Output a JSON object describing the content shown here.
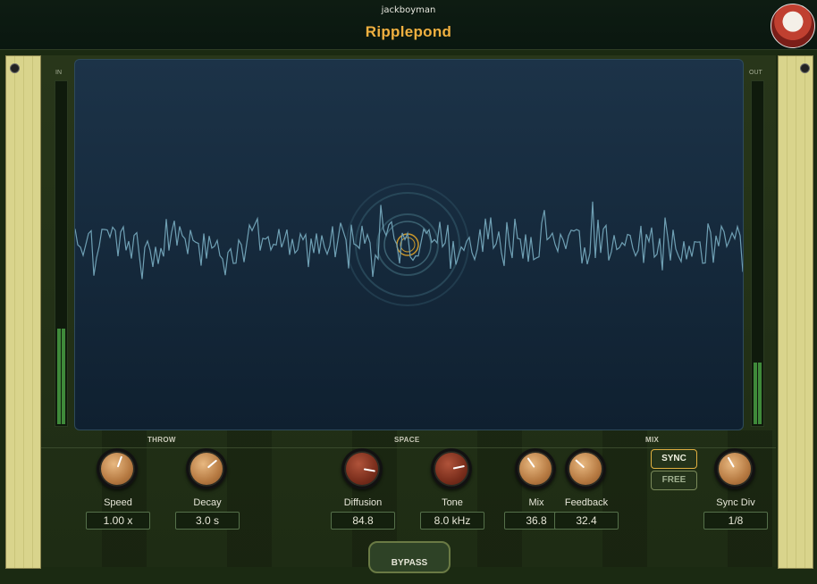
{
  "header": {
    "vendor": "jackboyman",
    "title": "Ripplepond"
  },
  "meters": {
    "in_label": "IN",
    "out_label": "OUT",
    "in_level": 0.28,
    "out_level": 0.18
  },
  "sections": {
    "throw": "THROW",
    "space": "SPACE",
    "mix": "MIX"
  },
  "knobs": [
    {
      "label": "Speed",
      "value": "1.00 x",
      "style": "tan"
    },
    {
      "label": "Decay",
      "value": "3.0 s",
      "style": "tan"
    },
    {
      "label": "Diffusion",
      "value": "84.8",
      "style": "red"
    },
    {
      "label": "Tone",
      "value": "8.0 kHz",
      "style": "red"
    },
    {
      "label": "Mix",
      "value": "36.8",
      "style": "tan"
    },
    {
      "label": "Feedback",
      "value": "32.4",
      "style": "tan"
    },
    {
      "label": "Sync Div",
      "value": "1/8",
      "style": "tan"
    }
  ],
  "buttons": {
    "sync": "SYNC",
    "free": "FREE",
    "bypass": "BYPASS"
  },
  "colors": {
    "accent": "#f0b040",
    "waveform": "#6fa0b4",
    "meter": "#3f8a3a"
  },
  "icons": {
    "avatar": "red-panda-avatar-icon",
    "ripple": "ripple-rings-icon"
  }
}
